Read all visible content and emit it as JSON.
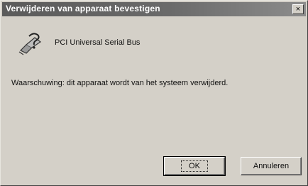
{
  "dialog": {
    "title": "Verwijderen van apparaat bevestigen",
    "close_glyph": "×",
    "device_icon": "usb-controller-icon",
    "device_name": "PCI Universal Serial Bus",
    "warning_text": "Waarschuwing: dit apparaat wordt van het systeem verwijderd.",
    "ok_label": "OK",
    "cancel_label": "Annuleren"
  }
}
